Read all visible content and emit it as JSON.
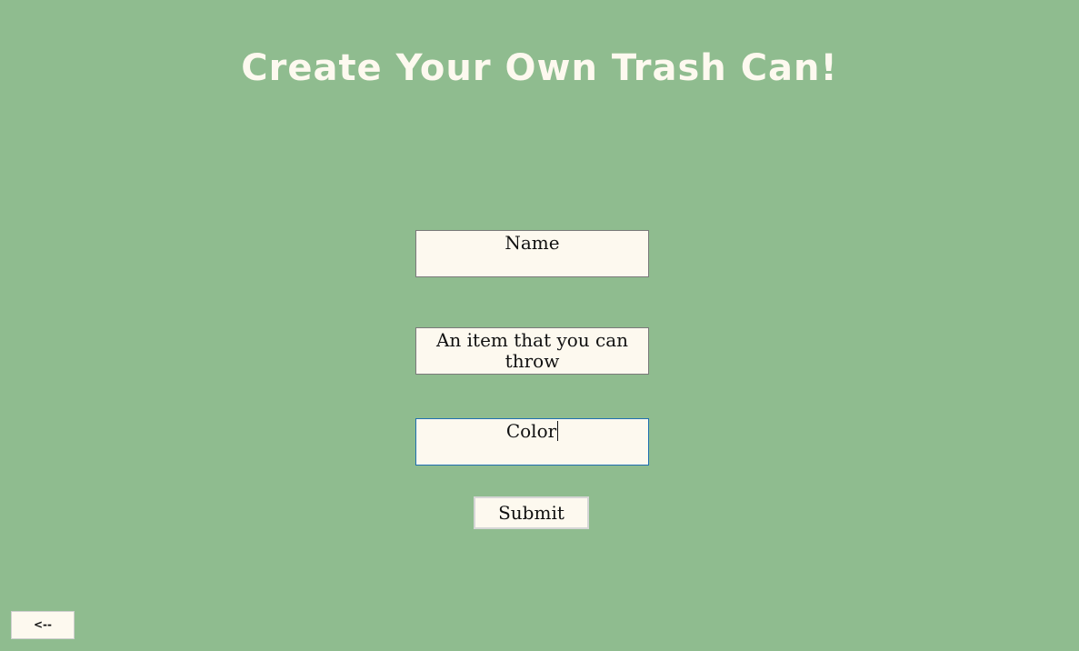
{
  "header": {
    "title": "Create Your Own Trash Can!"
  },
  "form": {
    "name_placeholder": "Name",
    "item_placeholder": "An item that you can throw",
    "color_value": "Color",
    "submit_label": "Submit"
  },
  "nav": {
    "back_label": "<--"
  },
  "colors": {
    "background": "#8fbc8f",
    "field_background": "#fdf9ef",
    "title_color": "#fdf9ef",
    "focus_border": "#1f6fb0"
  }
}
